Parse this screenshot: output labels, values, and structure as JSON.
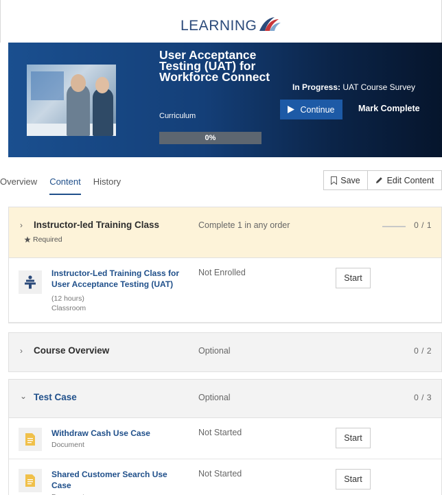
{
  "header": {
    "logo_text": "LEARNING"
  },
  "hero": {
    "title": "User Acceptance Testing (UAT) for Workforce Connect",
    "type": "Curriculum",
    "progress": {
      "percent": 0,
      "label": "0%"
    },
    "in_progress_label": "In Progress:",
    "in_progress_value": "UAT Course Survey",
    "continue_label": "Continue",
    "mark_complete_label": "Mark Complete"
  },
  "tabs": [
    {
      "label": "Overview",
      "active": false
    },
    {
      "label": "Content",
      "active": true
    },
    {
      "label": "History",
      "active": false
    }
  ],
  "actions": {
    "save_label": "Save",
    "edit_label": "Edit Content"
  },
  "sections": [
    {
      "title": "Instructor-led Training Class",
      "status": "Complete 1 in any order",
      "count": "0 / 1",
      "required_label": "Required",
      "items": [
        {
          "title": "Instructor-Led Training Class for User Acceptance Testing (UAT)",
          "duration": "(12 hours)",
          "type": "Classroom",
          "status": "Not Enrolled",
          "action": "Start",
          "icon": "classroom-icon"
        }
      ]
    },
    {
      "title": "Course Overview",
      "status": "Optional",
      "count": "0 / 2"
    },
    {
      "title": "Test Case",
      "status": "Optional",
      "count": "0 / 3",
      "items": [
        {
          "title": "Withdraw Cash Use Case",
          "type": "Document",
          "status": "Not Started",
          "action": "Start",
          "icon": "document-icon"
        },
        {
          "title": "Shared Customer Search Use Case",
          "type": "Document",
          "status": "Not Started",
          "action": "Start",
          "icon": "document-icon"
        }
      ]
    }
  ],
  "colors": {
    "brand": "#1f4f8a",
    "progress_fill": "#8bc34a",
    "required_bg": "#fdf3d9"
  }
}
